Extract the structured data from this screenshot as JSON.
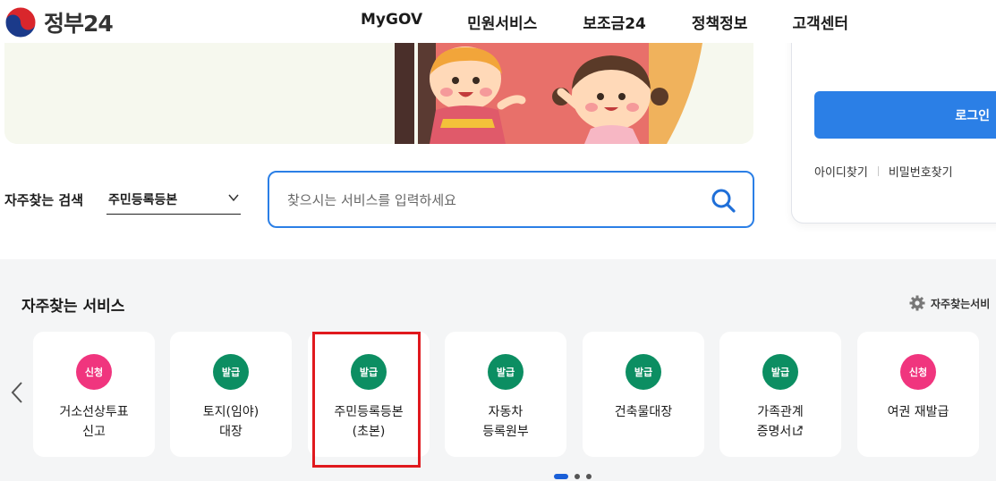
{
  "header": {
    "logo_text": "정부24",
    "nav": [
      "MyGOV",
      "민원서비스",
      "보조금24",
      "정책정보",
      "고객센터"
    ]
  },
  "login": {
    "button": "로그인",
    "find_id": "아이디찾기",
    "find_password": "비밀번호찾기"
  },
  "search": {
    "frequent_label": "자주찾는 검색",
    "selected_option": "주민등록등본",
    "placeholder": "찾으시는 서비스를 입력하세요"
  },
  "services": {
    "title": "자주찾는 서비스",
    "settings_label": "자주찾는서비",
    "cards": [
      {
        "badge": "신청",
        "badge_type": "apply",
        "label": "거소선상투표\n신고"
      },
      {
        "badge": "발급",
        "badge_type": "issue",
        "label": "토지(임야)\n대장"
      },
      {
        "badge": "발급",
        "badge_type": "issue",
        "label": "주민등록등본\n(초본)"
      },
      {
        "badge": "발급",
        "badge_type": "issue",
        "label": "자동차\n등록원부"
      },
      {
        "badge": "발급",
        "badge_type": "issue",
        "label": "건축물대장"
      },
      {
        "badge": "발급",
        "badge_type": "issue",
        "label": "가족관계\n증명서"
      },
      {
        "badge": "신청",
        "badge_type": "apply",
        "label": "여권 재발급"
      }
    ]
  },
  "colors": {
    "primary": "#2b7fe6",
    "apply_badge": "#f0357e",
    "issue_badge": "#0c8e62",
    "highlight": "#e0191e"
  }
}
